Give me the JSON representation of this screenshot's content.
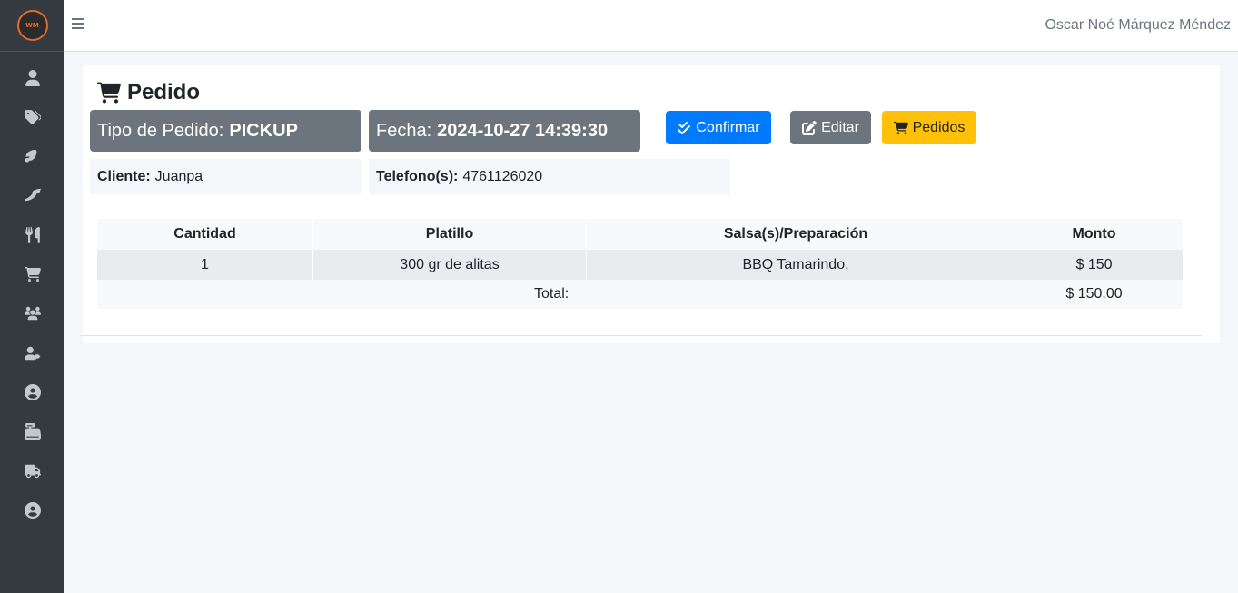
{
  "topbar": {
    "user_name": "Oscar Noé Márquez Méndez"
  },
  "sidebar": {
    "logo_text": "WM",
    "items": [
      {
        "icon": "user-icon"
      },
      {
        "icon": "tags-icon"
      },
      {
        "icon": "drumstick-icon"
      },
      {
        "icon": "pepper-icon"
      },
      {
        "icon": "utensils-icon"
      },
      {
        "icon": "cart-icon"
      },
      {
        "icon": "users-icon"
      },
      {
        "icon": "user-tag-icon"
      },
      {
        "icon": "user-circle-icon"
      },
      {
        "icon": "cash-register-icon"
      },
      {
        "icon": "truck-icon"
      },
      {
        "icon": "user-circle-icon"
      }
    ]
  },
  "page": {
    "title": "Pedido"
  },
  "order": {
    "type_label": "Tipo de Pedido:",
    "type_value": "PICKUP",
    "date_label": "Fecha:",
    "date_value": "2024-10-27 14:39:30",
    "client_label": "Cliente:",
    "client_value": "Juanpa",
    "phone_label": "Telefono(s):",
    "phone_value": "4761126020"
  },
  "buttons": {
    "confirm": "Confirmar",
    "edit": "Editar",
    "orders": "Pedidos"
  },
  "table": {
    "headers": [
      "Cantidad",
      "Platillo",
      "Salsa(s)/Preparación",
      "Monto"
    ],
    "rows": [
      [
        "1",
        "300 gr de alitas",
        "BBQ Tamarindo,",
        "$ 150"
      ]
    ],
    "total_label": "Total:",
    "total_value": "$ 150.00"
  },
  "colors": {
    "sidebar": "#343a40",
    "primary": "#007bff",
    "secondary": "#6c757d",
    "warning": "#ffc107",
    "brand_accent": "#e06b2a"
  }
}
